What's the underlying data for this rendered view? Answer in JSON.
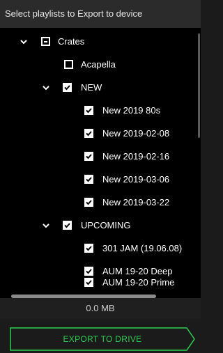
{
  "header": {
    "title": "Select playlists to Export to device"
  },
  "tree": {
    "root": {
      "label": "Crates",
      "state": "partial",
      "expanded": true
    },
    "items": [
      {
        "label": "Acapella",
        "state": "unchecked"
      },
      {
        "label": "NEW",
        "state": "checked",
        "expanded": true
      },
      {
        "label": "New 2019 80s",
        "state": "checked"
      },
      {
        "label": "New 2019-02-08",
        "state": "checked"
      },
      {
        "label": "New 2019-02-16",
        "state": "checked"
      },
      {
        "label": "New 2019-03-06",
        "state": "checked"
      },
      {
        "label": "New 2019-03-22",
        "state": "checked"
      },
      {
        "label": "UPCOMING",
        "state": "checked",
        "expanded": true
      },
      {
        "label": "301 JAM (19.06.08)",
        "state": "checked"
      },
      {
        "label": "AUM 19-20 Deep",
        "state": "checked"
      },
      {
        "label": "AUM 19-20 Prime",
        "state": "checked"
      }
    ]
  },
  "footer": {
    "size": "0.0 MB",
    "export_label": "EXPORT TO DRIVE"
  },
  "colors": {
    "accent": "#2ecc52",
    "background": "#000000",
    "header": "#2b2b2b"
  },
  "icons": [
    "chevron-down-icon",
    "checkbox-checked-icon",
    "checkbox-empty-icon",
    "checkbox-partial-icon"
  ]
}
